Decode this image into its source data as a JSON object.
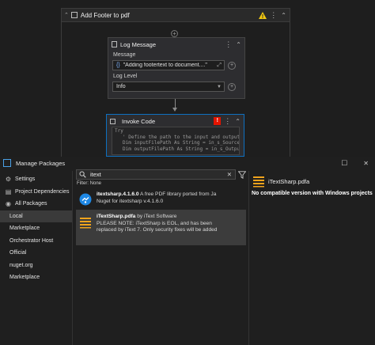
{
  "workflow": {
    "sequence_title": "Add Footer to pdf",
    "log_message": {
      "title": "Log Message",
      "message_label": "Message",
      "message_value": "\"Adding footertext to document....\"",
      "level_label": "Log Level",
      "level_value": "Info"
    },
    "invoke_code": {
      "title": "Invoke Code",
      "error_badge": "!",
      "code_lines": [
        "Try",
        "' Define the path to the input and output PDF file",
        "Dim inputFilePath As String = in_s_SourceFile",
        "Dim outputFilePath As String = in_s_OutputFile"
      ]
    }
  },
  "window": {
    "title": "Manage Packages",
    "maximize_glyph": "☐",
    "close_glyph": "✕"
  },
  "sidebar": {
    "items": [
      {
        "label": "Settings",
        "icon": "⚙"
      },
      {
        "label": "Project Dependencies",
        "icon": "▤"
      },
      {
        "label": "All Packages",
        "icon": "◉"
      },
      {
        "label": "Local",
        "icon": ""
      },
      {
        "label": "Marketplace",
        "icon": ""
      },
      {
        "label": "Orchestrator Host",
        "icon": ""
      },
      {
        "label": "Official",
        "icon": ""
      },
      {
        "label": "nuget.org",
        "icon": ""
      },
      {
        "label": "Marketplace",
        "icon": ""
      }
    ],
    "selected_index": 3
  },
  "search": {
    "value": "itext",
    "clear_glyph": "✕",
    "filter_label": "Filter: None"
  },
  "packages": [
    {
      "name": "itextsharp.4.1.6.0",
      "author_line": "A free PDF library ported from Ja",
      "line2": "Nuget for itextsharp v.4.1.6.0",
      "line3": "",
      "icon": "itext-blue-icon"
    },
    {
      "name": "iTextSharp.pdfa",
      "author_line": "by  iText Software",
      "line2": "PLEASE NOTE: iTextSharp is EOL, and has been",
      "line3": "replaced by iText 7. Only security fixes will be added",
      "icon": "itext-stack-icon"
    }
  ],
  "detail": {
    "package_name": "iTextSharp.pdfa",
    "message": "No compatible version with Windows projects"
  },
  "colors": {
    "accent_blue": "#0e70c0",
    "error_red": "#e51400",
    "warning_yellow": "#f2c811",
    "itext_orange": "#f2a41c"
  }
}
